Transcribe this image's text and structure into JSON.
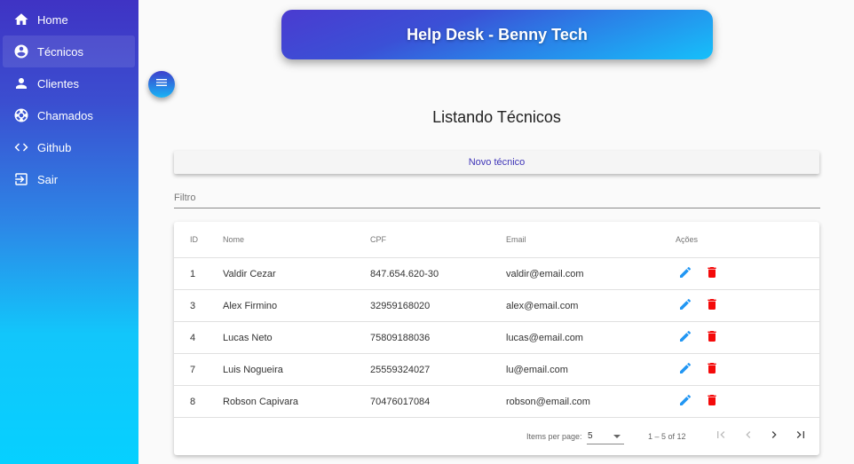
{
  "app": {
    "banner_title": "Help Desk - Benny Tech"
  },
  "sidebar": {
    "items": [
      {
        "label": "Home",
        "icon": "home-icon",
        "active": false
      },
      {
        "label": "Técnicos",
        "icon": "account-circle-icon",
        "active": true
      },
      {
        "label": "Clientes",
        "icon": "person-icon",
        "active": false
      },
      {
        "label": "Chamados",
        "icon": "lifebuoy-icon",
        "active": false
      },
      {
        "label": "Github",
        "icon": "code-icon",
        "active": false
      },
      {
        "label": "Sair",
        "icon": "logout-icon",
        "active": false
      }
    ]
  },
  "main": {
    "title": "Listando Técnicos",
    "new_button_label": "Novo técnico",
    "filter_placeholder": "Filtro"
  },
  "table": {
    "headers": {
      "id": "ID",
      "name": "Nome",
      "cpf": "CPF",
      "email": "Email",
      "actions": "Ações"
    },
    "rows": [
      {
        "id": "1",
        "name": "Valdir Cezar",
        "cpf": "847.654.620-30",
        "email": "valdir@email.com"
      },
      {
        "id": "3",
        "name": "Alex Firmino",
        "cpf": "32959168020",
        "email": "alex@email.com"
      },
      {
        "id": "4",
        "name": "Lucas Neto",
        "cpf": "75809188036",
        "email": "lucas@email.com"
      },
      {
        "id": "7",
        "name": "Luis Nogueira",
        "cpf": "25559324027",
        "email": "lu@email.com"
      },
      {
        "id": "8",
        "name": "Robson Capivara",
        "cpf": "70476017084",
        "email": "robson@email.com"
      }
    ]
  },
  "paginator": {
    "items_per_page_label": "Items per page:",
    "page_size": "5",
    "range_label": "1 – 5 of 12"
  },
  "colors": {
    "edit_icon": "#2196f3",
    "delete_icon": "#f40a0a",
    "accent": "#3f35b8"
  }
}
